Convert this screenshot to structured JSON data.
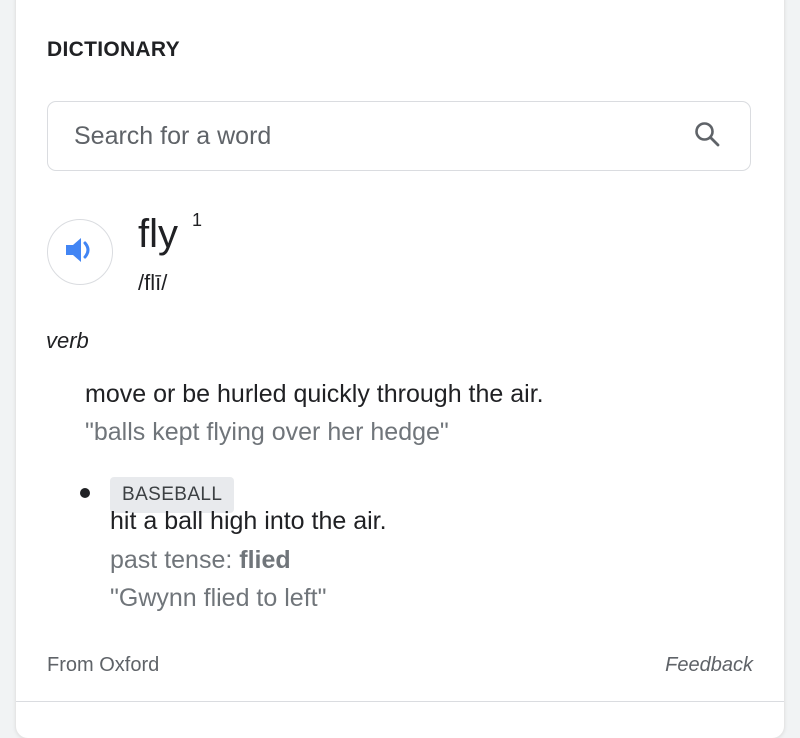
{
  "card": {
    "heading": "DICTIONARY"
  },
  "search": {
    "placeholder": "Search for a word",
    "value": "",
    "icon": "search-icon"
  },
  "entry": {
    "word": "fly",
    "homograph_index": "1",
    "phonetic": "/flī/",
    "speaker_icon": "volume-icon",
    "part_of_speech": "verb",
    "senses": [
      {
        "definition": "move or be hurled quickly through the air.",
        "example": "\"balls kept flying over her hedge\""
      },
      {
        "label": "BASEBALL",
        "definition": "hit a ball high into the air.",
        "past_tense_label": "past tense: ",
        "past_tense_value": "flied",
        "example": "\"Gwynn flied to left\""
      }
    ]
  },
  "footer": {
    "source": "From Oxford",
    "feedback": "Feedback"
  },
  "colors": {
    "accent": "#4285f4",
    "text": "#202124",
    "muted": "#70757a",
    "border": "#dadce0"
  }
}
